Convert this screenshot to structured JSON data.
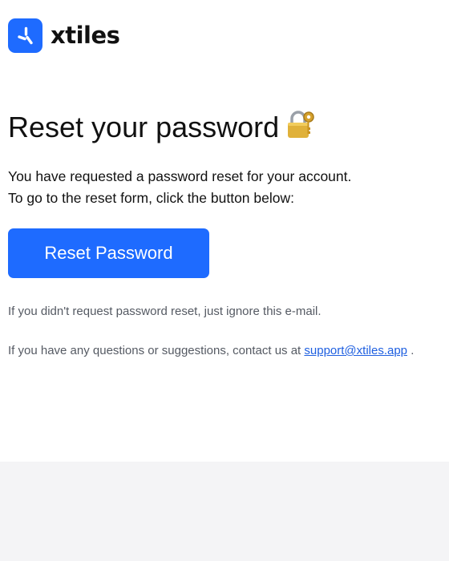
{
  "logo": {
    "icon": "xtiles-logo-icon",
    "name": "xtiles"
  },
  "heading": {
    "text": "Reset your password",
    "icon": "lock-with-key-icon"
  },
  "body": {
    "line1": "You have requested a password reset for your account.",
    "line2": "To go to the reset form, click the button below:"
  },
  "button": {
    "label": "Reset Password"
  },
  "notes": {
    "ignore": "If you didn't request password reset, just ignore this e-mail.",
    "contact_prefix": "If you have any questions or suggestions, contact us at ",
    "contact_email": "support@xtiles.app",
    "contact_suffix": " ."
  },
  "colors": {
    "accent": "#1e6bff",
    "footer_bg": "#f4f4f6",
    "link": "#1e5fe0"
  }
}
